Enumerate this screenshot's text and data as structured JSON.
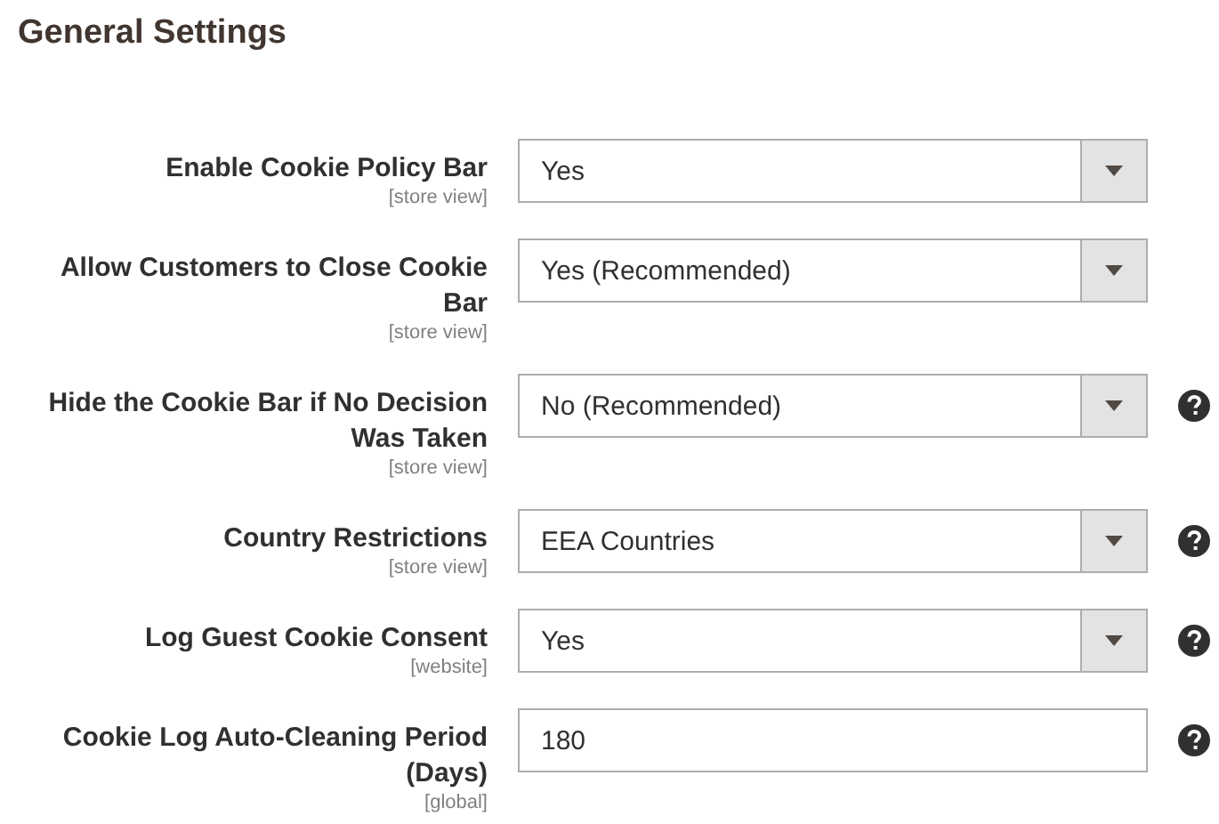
{
  "section": {
    "title": "General Settings"
  },
  "fields": [
    {
      "kind": "select",
      "label": "Enable Cookie Policy Bar",
      "scope": "[store view]",
      "value": "Yes",
      "help": false
    },
    {
      "kind": "select",
      "label": "Allow Customers to Close Cookie Bar",
      "scope": "[store view]",
      "value": "Yes (Recommended)",
      "help": false
    },
    {
      "kind": "select",
      "label": "Hide the Cookie Bar if No Decision Was Taken",
      "scope": "[store view]",
      "value": "No (Recommended)",
      "help": true
    },
    {
      "kind": "select",
      "label": "Country Restrictions",
      "scope": "[store view]",
      "value": "EEA Countries",
      "help": true
    },
    {
      "kind": "select",
      "label": "Log Guest Cookie Consent",
      "scope": "[website]",
      "value": "Yes",
      "help": true
    },
    {
      "kind": "input",
      "label": "Cookie Log Auto-Cleaning Period (Days)",
      "scope": "[global]",
      "value": "180",
      "help": true
    }
  ]
}
